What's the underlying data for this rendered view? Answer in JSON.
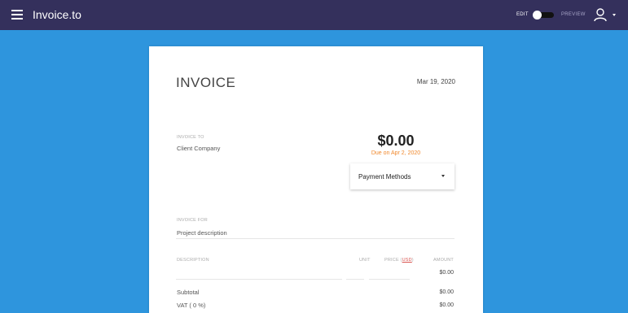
{
  "topbar": {
    "brand": "Invoice.to",
    "edit_label": "EDIT",
    "preview_label": "PREVIEW"
  },
  "invoice": {
    "title": "INVOICE",
    "date": "Mar 19, 2020",
    "invoice_to_label": "INVOICE TO",
    "client": "Client Company",
    "total": "$0.00",
    "due": "Due on Apr 2, 2020",
    "payment_methods_label": "Payment Methods",
    "invoice_for_label": "INVOICE FOR",
    "project_description": "Project description",
    "columns": {
      "description": "DESCRIPTION",
      "unit": "UNIT",
      "price_prefix": "PRICE (",
      "currency": "USD",
      "price_suffix": ")",
      "amount": "AMOUNT"
    },
    "line_amount": "$0.00",
    "subtotal_label": "Subtotal",
    "subtotal_value": "$0.00",
    "vat_label": "VAT ( 0 %)",
    "vat_value": "$0.00"
  },
  "colors": {
    "topbar": "#34305c",
    "background": "#2e95dd",
    "due_accent": "#f0882c",
    "currency_link": "#d9534f"
  },
  "icons": [
    "hamburger-menu-icon",
    "user-icon",
    "chevron-down-icon"
  ]
}
